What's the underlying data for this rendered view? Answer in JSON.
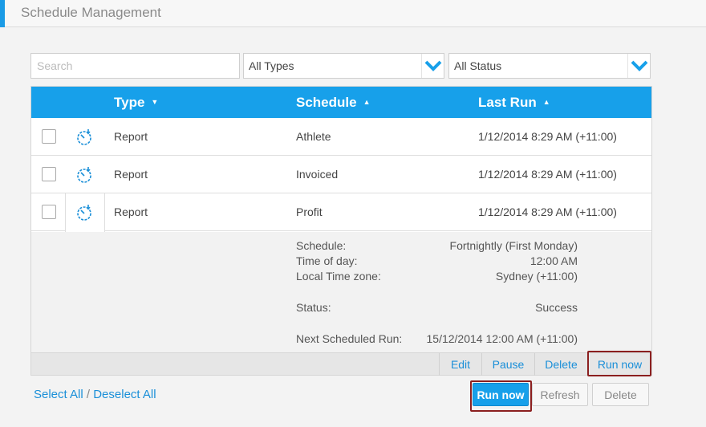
{
  "header": {
    "title": "Schedule Management"
  },
  "filters": {
    "search_placeholder": "Search",
    "type_value": "All Types",
    "status_value": "All Status"
  },
  "grid": {
    "columns": {
      "type": "Type",
      "schedule": "Schedule",
      "last_run": "Last Run"
    },
    "rows": [
      {
        "type": "Report",
        "schedule": "Athlete",
        "last_run": "1/12/2014 8:29 AM (+11:00)"
      },
      {
        "type": "Report",
        "schedule": "Invoiced",
        "last_run": "1/12/2014 8:29 AM (+11:00)"
      },
      {
        "type": "Report",
        "schedule": "Profit",
        "last_run": "1/12/2014 8:29 AM (+11:00)"
      }
    ],
    "details": {
      "schedule_label": "Schedule:",
      "schedule_value": "Fortnightly (First Monday)",
      "time_label": "Time of day:",
      "time_value": "12:00 AM",
      "tz_label": "Local Time zone:",
      "tz_value": "Sydney (+11:00)",
      "status_label": "Status:",
      "status_value": "Success",
      "next_label": "Next Scheduled Run:",
      "next_value": "15/12/2014 12:00 AM (+11:00)"
    },
    "actions": {
      "edit": "Edit",
      "pause": "Pause",
      "delete": "Delete",
      "run_now": "Run now"
    }
  },
  "footer": {
    "select_all": "Select All",
    "separator": "/",
    "deselect_all": "Deselect All",
    "run_now": "Run now",
    "refresh": "Refresh",
    "delete": "Delete"
  },
  "icons": {
    "row_icon": "stopwatch-icon",
    "dropdown": "chevron-down-icon"
  },
  "colors": {
    "accent": "#17a0ea",
    "highlight": "#8b1f1f"
  }
}
